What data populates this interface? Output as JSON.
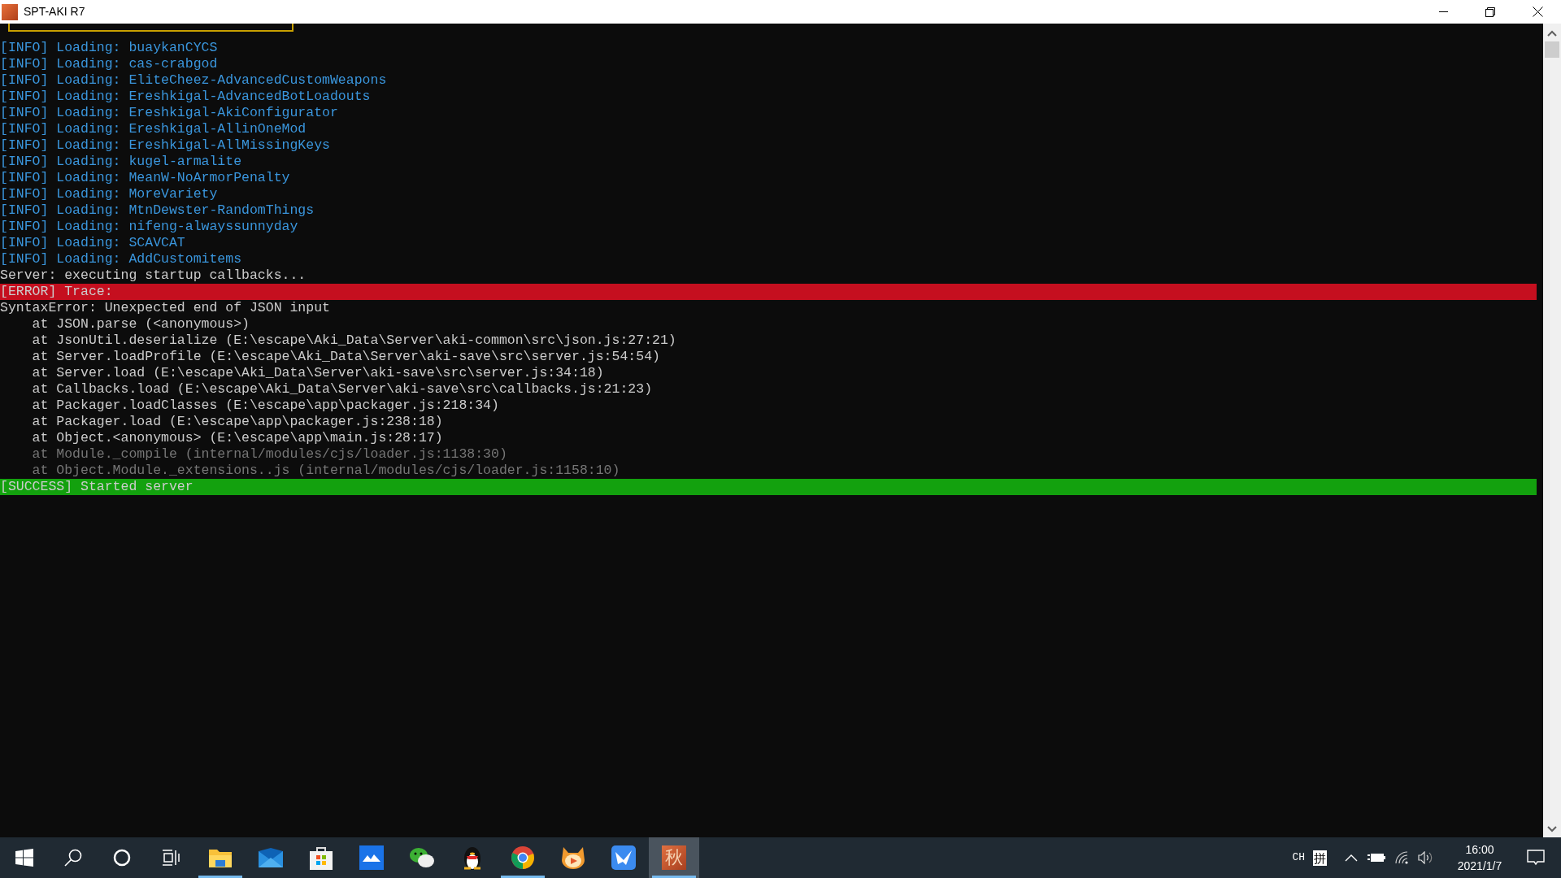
{
  "window": {
    "title": "SPT-AKI R7"
  },
  "console": {
    "lines": [
      {
        "kind": "info",
        "text": "[INFO] Loading: buaykanCYCS"
      },
      {
        "kind": "info",
        "text": "[INFO] Loading: cas-crabgod"
      },
      {
        "kind": "info",
        "text": "[INFO] Loading: EliteCheez-AdvancedCustomWeapons"
      },
      {
        "kind": "info",
        "text": "[INFO] Loading: Ereshkigal-AdvancedBotLoadouts"
      },
      {
        "kind": "info",
        "text": "[INFO] Loading: Ereshkigal-AkiConfigurator"
      },
      {
        "kind": "info",
        "text": "[INFO] Loading: Ereshkigal-AllinOneMod"
      },
      {
        "kind": "info",
        "text": "[INFO] Loading: Ereshkigal-AllMissingKeys"
      },
      {
        "kind": "info",
        "text": "[INFO] Loading: kugel-armalite"
      },
      {
        "kind": "info",
        "text": "[INFO] Loading: MeanW-NoArmorPenalty"
      },
      {
        "kind": "info",
        "text": "[INFO] Loading: MoreVariety"
      },
      {
        "kind": "info",
        "text": "[INFO] Loading: MtnDewster-RandomThings"
      },
      {
        "kind": "info",
        "text": "[INFO] Loading: nifeng-alwayssunnyday"
      },
      {
        "kind": "info",
        "text": "[INFO] Loading: SCAVCAT"
      },
      {
        "kind": "info",
        "text": "[INFO] Loading: AddCustomitems"
      },
      {
        "kind": "plain",
        "text": "Server: executing startup callbacks..."
      },
      {
        "kind": "error",
        "text": "[ERROR] Trace:"
      },
      {
        "kind": "plain",
        "text": "SyntaxError: Unexpected end of JSON input"
      },
      {
        "kind": "plain",
        "text": "    at JSON.parse (<anonymous>)"
      },
      {
        "kind": "plain",
        "text": "    at JsonUtil.deserialize (E:\\escape\\Aki_Data\\Server\\aki-common\\src\\json.js:27:21)"
      },
      {
        "kind": "plain",
        "text": "    at Server.loadProfile (E:\\escape\\Aki_Data\\Server\\aki-save\\src\\server.js:54:54)"
      },
      {
        "kind": "plain",
        "text": "    at Server.load (E:\\escape\\Aki_Data\\Server\\aki-save\\src\\server.js:34:18)"
      },
      {
        "kind": "plain",
        "text": "    at Callbacks.load (E:\\escape\\Aki_Data\\Server\\aki-save\\src\\callbacks.js:21:23)"
      },
      {
        "kind": "plain",
        "text": "    at Packager.loadClasses (E:\\escape\\app\\packager.js:218:34)"
      },
      {
        "kind": "plain",
        "text": "    at Packager.load (E:\\escape\\app\\packager.js:238:18)"
      },
      {
        "kind": "plain",
        "text": "    at Object.<anonymous> (E:\\escape\\app\\main.js:28:17)"
      },
      {
        "kind": "dim",
        "text": "    at Module._compile (internal/modules/cjs/loader.js:1138:30)"
      },
      {
        "kind": "dim",
        "text": "    at Object.Module._extensions..js (internal/modules/cjs/loader.js:1158:10)"
      },
      {
        "kind": "success",
        "text": "[SUCCESS] Started server"
      }
    ]
  },
  "taskbar": {
    "apps": [
      {
        "kind": "start",
        "active": false
      },
      {
        "kind": "search",
        "active": false
      },
      {
        "kind": "cortana",
        "active": false
      },
      {
        "kind": "taskview",
        "active": false
      },
      {
        "kind": "explorer",
        "active": true
      },
      {
        "kind": "mail",
        "active": false
      },
      {
        "kind": "store",
        "active": false
      },
      {
        "kind": "cloud",
        "active": false
      },
      {
        "kind": "chat",
        "active": false
      },
      {
        "kind": "penguin",
        "active": false
      },
      {
        "kind": "browser",
        "active": true
      },
      {
        "kind": "cat",
        "active": false
      },
      {
        "kind": "bird",
        "active": false
      },
      {
        "kind": "app",
        "active": true,
        "selected": true,
        "glyph": "秋"
      }
    ],
    "tray": {
      "language": "CH",
      "ime": "拼",
      "time": "16:00",
      "date": "2021/1/7"
    }
  }
}
